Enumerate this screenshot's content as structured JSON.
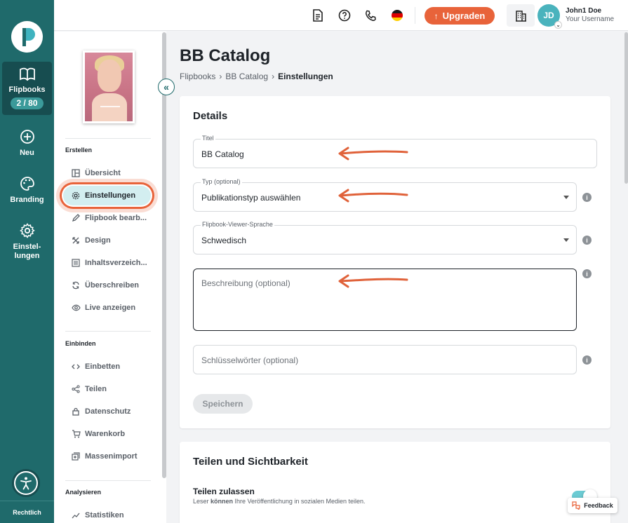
{
  "rail": {
    "items": [
      {
        "label": "Flipbooks",
        "badge": "2 / 80",
        "icon": "book-open-icon"
      },
      {
        "label": "Neu",
        "icon": "plus-circle-icon"
      },
      {
        "label": "Branding",
        "icon": "palette-icon"
      },
      {
        "label": "Einstel-\nlungen",
        "icon": "gear-icon"
      }
    ],
    "bottom_label": "Rechtlich"
  },
  "topbar": {
    "upgrade_label": "Upgraden",
    "user_initials": "JD",
    "user_name": "John1 Doe",
    "user_sub": "Your Username",
    "language_flag": "de"
  },
  "subnav": {
    "sections": [
      {
        "title": "Erstellen",
        "items": [
          {
            "label": "Übersicht",
            "icon": "layout-icon"
          },
          {
            "label": "Einstellungen",
            "icon": "gear-icon",
            "active": true
          },
          {
            "label": "Flipbook bearb...",
            "icon": "pencil-icon"
          },
          {
            "label": "Design",
            "icon": "tools-icon"
          },
          {
            "label": "Inhaltsverzeich...",
            "icon": "toc-icon"
          },
          {
            "label": "Überschreiben",
            "icon": "refresh-icon"
          },
          {
            "label": "Live anzeigen",
            "icon": "eye-icon"
          }
        ]
      },
      {
        "title": "Einbinden",
        "items": [
          {
            "label": "Einbetten",
            "icon": "code-icon"
          },
          {
            "label": "Teilen",
            "icon": "share-icon"
          },
          {
            "label": "Datenschutz",
            "icon": "lock-icon"
          },
          {
            "label": "Warenkorb",
            "icon": "cart-icon"
          },
          {
            "label": "Massenimport",
            "icon": "import-icon"
          }
        ]
      },
      {
        "title": "Analysieren",
        "items": [
          {
            "label": "Statistiken",
            "icon": "chart-line-icon"
          }
        ]
      }
    ]
  },
  "page": {
    "title": "BB Catalog",
    "breadcrumb": [
      "Flipbooks",
      "BB Catalog",
      "Einstellungen"
    ]
  },
  "details": {
    "title": "Details",
    "titel_label": "Titel",
    "titel_value": "BB Catalog",
    "typ_label": "Typ (optional)",
    "typ_value": "Publikationstyp auswählen",
    "sprache_label": "Flipbook-Viewer-Sprache",
    "sprache_value": "Schwedisch",
    "beschreibung_placeholder": "Beschreibung (optional)",
    "keywords_placeholder": "Schlüsselwörter (optional)",
    "save_label": "Speichern"
  },
  "sharing": {
    "title": "Teilen und Sichtbarkeit",
    "label": "Teilen zulassen",
    "desc_before": "Leser ",
    "desc_bold": "können",
    "desc_after": " Ihre Veröffentlichung in sozialen Medien teilen.",
    "enabled": true
  },
  "feedback_label": "Feedback",
  "colors": {
    "rail": "#1f6a6b",
    "accent": "#e8633a",
    "active_bg": "#d3eef0",
    "toggle": "#6ccbd3"
  }
}
